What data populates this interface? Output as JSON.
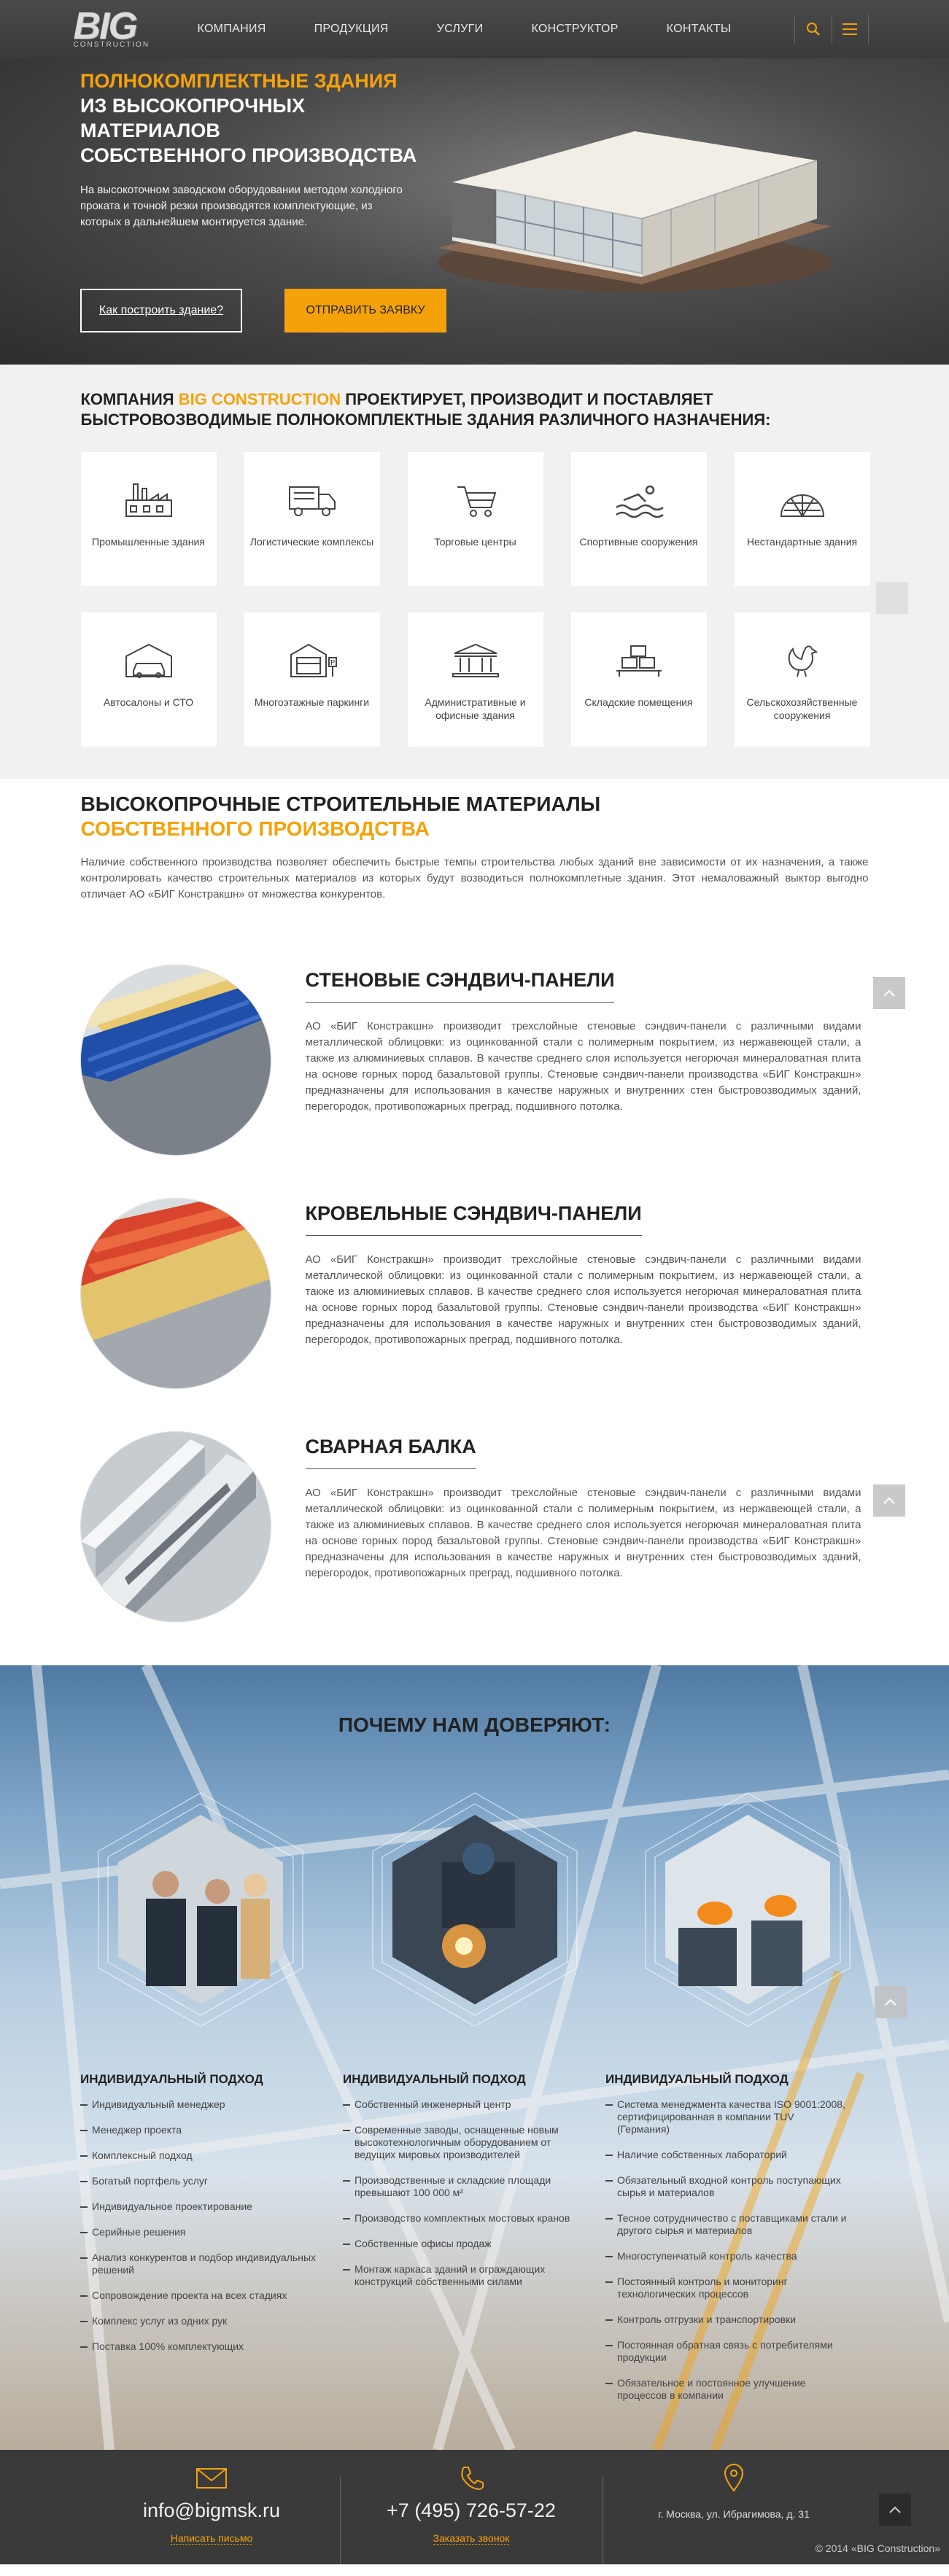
{
  "header": {
    "logo_big": "BIG",
    "logo_sub": "CONSTRUCTION",
    "nav": [
      "Компания",
      "Продукция",
      "Услуги",
      "Конструктор",
      "Контакты"
    ],
    "accent": "#f5a20a"
  },
  "hero": {
    "title_accent": "Полнокомплектные здания",
    "title_line2": "из высокопрочных материалов",
    "title_line3": "собственного производства",
    "text": "На высокоточном заводском оборудовании методом холодного проката и точной резки производятся комплектующие, из которых в дальнейшем монтируется здание.",
    "btn_how": "Как построить здание?",
    "btn_order": "Отправить заявку"
  },
  "types": {
    "title_pre": "Компания ",
    "title_brand": "BIG CONSTRUCTION",
    "title_post": " проектирует, производит и поставляет быстровозводимые полнокомплектные здания различного назначения:",
    "items": [
      {
        "label": "Промышленные здания",
        "icon": "factory-icon"
      },
      {
        "label": "Логистические комплексы",
        "icon": "truck-icon"
      },
      {
        "label": "Торговые центры",
        "icon": "cart-icon"
      },
      {
        "label": "Спортивные сооружения",
        "icon": "swimmer-icon"
      },
      {
        "label": "Нестандартные здания",
        "icon": "dome-icon"
      },
      {
        "label": "Автосалоны и СТО",
        "icon": "garage-car-icon"
      },
      {
        "label": "Многоэтажные паркинги",
        "icon": "parking-icon"
      },
      {
        "label": "Административные и офисные здания",
        "icon": "office-building-icon"
      },
      {
        "label": "Складские помещения",
        "icon": "warehouse-icon"
      },
      {
        "label": "Сельскохозяйственные сооружения",
        "icon": "rooster-icon"
      }
    ]
  },
  "materials": {
    "title_line1": "Высокопрочные строительные материалы",
    "title_line2": "собственного производства",
    "intro": "Наличие собственного производства позволяет обеспечить быстрые темпы строительства любых зданий вне зависимости от их назначения, а также контролировать качество строительных материалов из которых будут возводиться полнокомплетные здания. Этот немаловажный выктор выгодно отличает АО «БИГ Констракшн» от множества конкурентов.",
    "products": [
      {
        "title": "Стеновые сэндвич-панели",
        "desc": "АО «БИГ Констракшн» производит трехслойные стеновые сэндвич-панели с различными видами металлической облицовки: из оцинкованной стали с полимерным покрытием, из нержавеющей стали, а также из алюминиевых сплавов. В качестве среднего слоя используется негорючая минераловатная плита на основе горных пород базальтовой группы. Стеновые сэндвич-панели производства «БИГ Констракшн» предназначены для использования в качестве наружных и внутренних стен быстровозводимых зданий, перегородок, противопожарных преград, подшивного потолка."
      },
      {
        "title": "Кровельные сэндвич-панели",
        "desc": "АО «БИГ Констракшн» производит трехслойные стеновые сэндвич-панели с различными видами металлической облицовки: из оцинкованной стали с полимерным покрытием, из нержавеющей стали, а также из алюминиевых сплавов. В качестве среднего слоя используется негорючая минераловатная плита на основе горных пород базальтовой группы. Стеновые сэндвич-панели производства «БИГ Констракшн» предназначены для использования в качестве наружных и внутренних стен быстровозводимых зданий, перегородок, противопожарных преград, подшивного потолка."
      },
      {
        "title": "Сварная балка",
        "desc": "АО «БИГ Констракшн» производит трехслойные стеновые сэндвич-панели с различными видами металлической облицовки: из оцинкованной стали с полимерным покрытием, из нержавеющей стали, а также из алюминиевых сплавов. В качестве среднего слоя используется негорючая минераловатная плита на основе горных пород базальтовой группы. Стеновые сэндвич-панели производства «БИГ Констракшн» предназначены для использования в качестве наружных и внутренних стен быстровозводимых зданий, перегородок, противопожарных преград, подшивного потолка."
      }
    ]
  },
  "trust": {
    "title": "Почему нам доверяют:",
    "columns": [
      {
        "title": "Индивидуальный подход",
        "items": [
          "Индивидуальный менеджер",
          "Менеджер проекта",
          "Комплексный подход",
          "Богатый портфель услуг",
          "Индивидуальное проектирование",
          "Серийные решения",
          "Анализ конкурентов и подбор индивидуальных решений",
          "Сопровождение проекта на всех стадиях",
          "Комплекс услуг из одних рук",
          "Поставка 100% комплектующих"
        ]
      },
      {
        "title": "Индивидуальный подход",
        "items": [
          "Собственный инженерный центр",
          "Современные заводы, оснащенные новым высокотехнологичным оборудованием от ведущих мировых производителей",
          "Производственные и складские площади превышают 100 000 м²",
          "Производство комплектных мостовых кранов",
          "Собственные офисы продаж",
          "Монтаж каркаса зданий и ограждающих конструкций собственными силами"
        ]
      },
      {
        "title": "Индивидуальный подход",
        "items": [
          "Система менеджмента качества ISO 9001:2008, сертифицированная в компании TUV (Германия)",
          "Наличие собственных лабораторий",
          "Обязательный входной контроль поступающих сырья и материалов",
          "Тесное сотрудничество с поставщиками стали и другого сырья и материалов",
          "Многоступенчатый контроль качества",
          "Постоянный контроль и мониторинг технологических процессов",
          "Контроль отгрузки и транспортировки",
          "Постоянная обратная связь с потребителями продукции",
          "Обязательное и постоянное улучшение процессов в компании"
        ]
      }
    ]
  },
  "footer": {
    "email": "info@bigmsk.ru",
    "email_link": "Написать письмо",
    "phone": "+7 (495) 726-57-22",
    "phone_link": "Заказать звонок",
    "address": "г. Москва, ул. Ибрагимова, д. 31",
    "copyright": "© 2014 «BIG Construction»"
  }
}
